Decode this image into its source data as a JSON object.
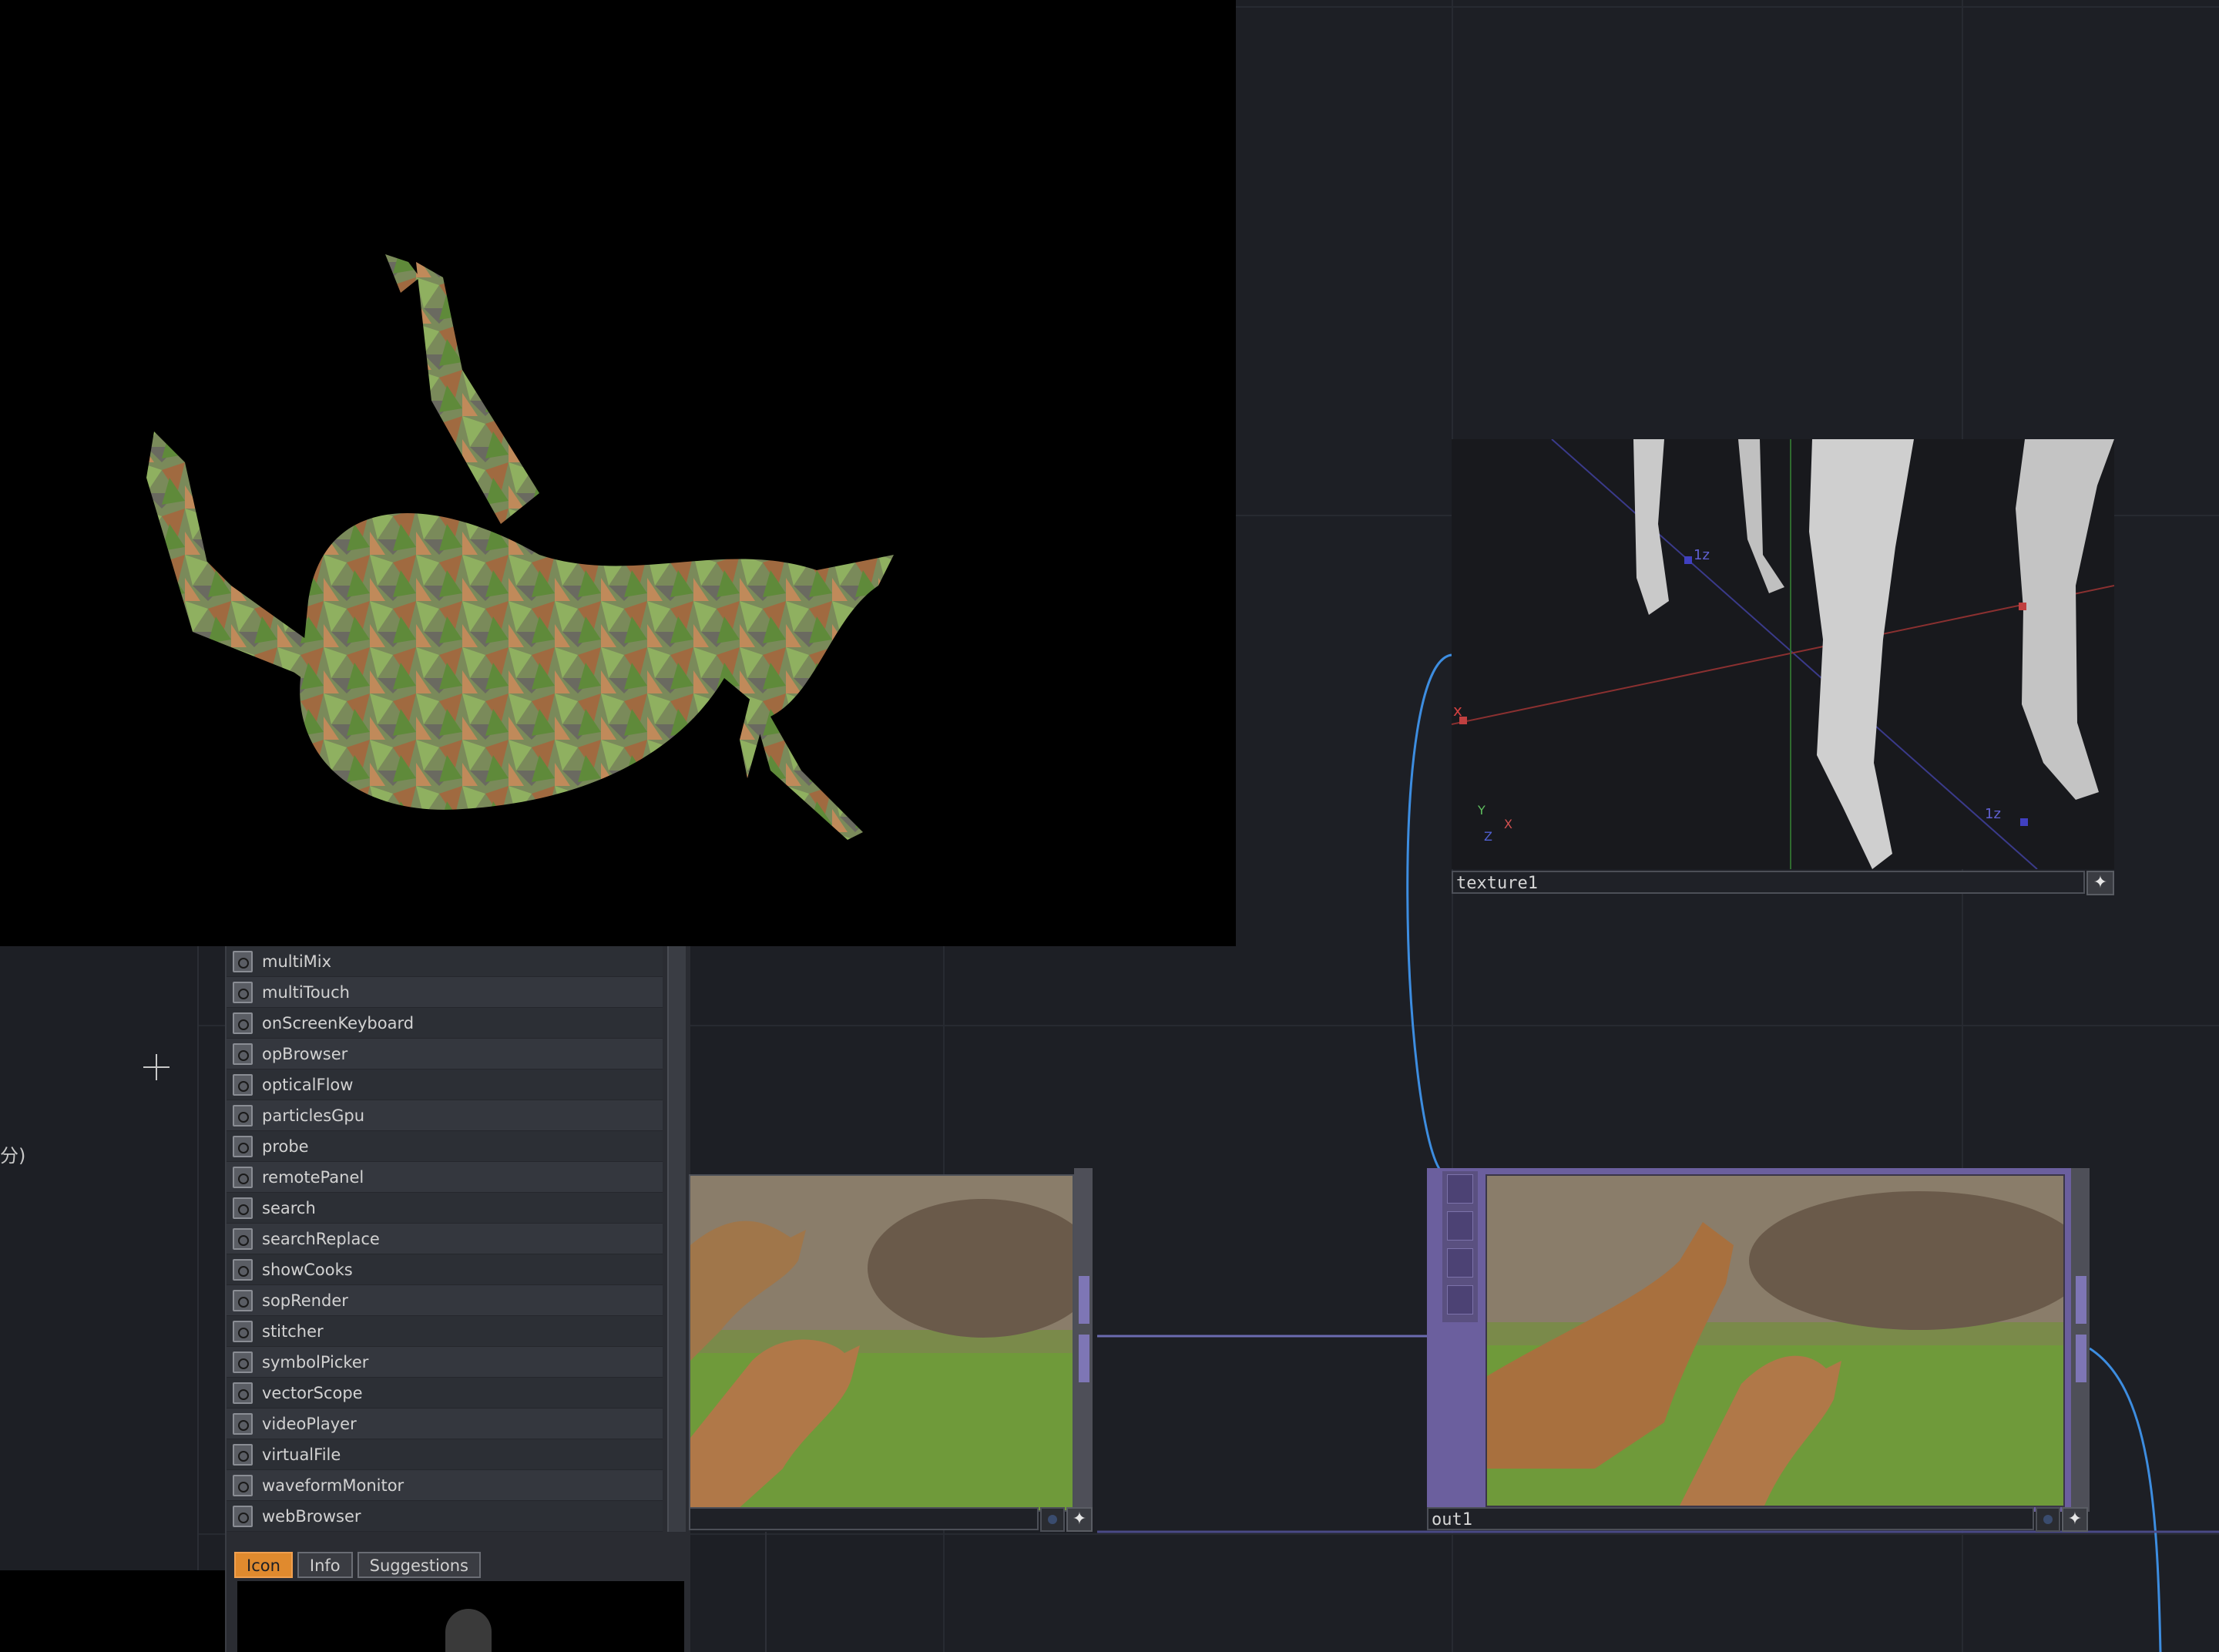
{
  "network": {
    "texture_node": {
      "label": "texture1"
    },
    "out_node": {
      "label": "out1"
    },
    "mid_node": {
      "label": ""
    }
  },
  "viewer3d": {
    "axis_labels": {
      "x": "x",
      "z1": "1z",
      "z2": "1z"
    }
  },
  "gizmo": {
    "y": "Y",
    "x": "X",
    "z": "Z"
  },
  "left_panel": {
    "jp_text": "分)"
  },
  "palette": {
    "items": [
      "multiMix",
      "multiTouch",
      "onScreenKeyboard",
      "opBrowser",
      "opticalFlow",
      "particlesGpu",
      "probe",
      "remotePanel",
      "search",
      "searchReplace",
      "showCooks",
      "sopRender",
      "stitcher",
      "symbolPicker",
      "vectorScope",
      "videoPlayer",
      "virtualFile",
      "waveformMonitor",
      "webBrowser"
    ],
    "tabs": {
      "icon": "Icon",
      "info": "Info",
      "suggestions": "Suggestions"
    },
    "active_tab": "Icon"
  },
  "colors": {
    "background": "#1d1f25",
    "wire_blue": "#3d8de0",
    "wire_purple": "#6b6bb0",
    "node_purple": "#6b5f9e",
    "tab_active": "#e08a2e"
  }
}
